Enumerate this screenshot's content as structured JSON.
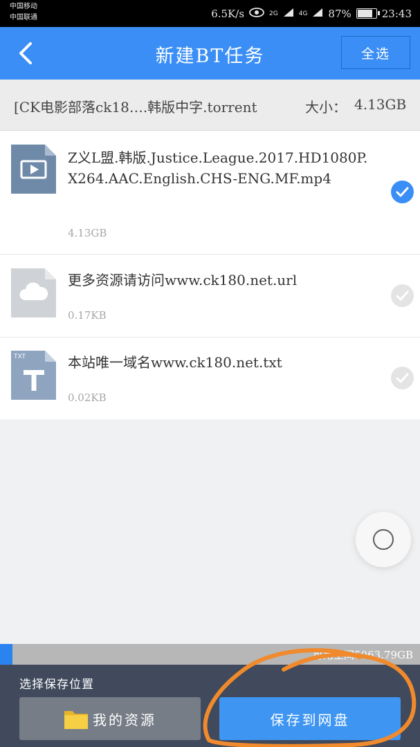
{
  "status_bar": {
    "carrier_1": "中国移动",
    "carrier_2": "中国联通",
    "speed": "6.5K/s",
    "signal_1": "2G",
    "signal_2": "4G",
    "battery": "87%",
    "battery_level": 0.87,
    "time": "23:43"
  },
  "header": {
    "title": "新建BT任务",
    "select_all": "全选"
  },
  "torrent": {
    "name": "[CK电影部落ck18….韩版中字.torrent",
    "size_label": "大小：",
    "size": "4.13GB"
  },
  "files": [
    {
      "name": "Z义L盟.韩版.Justice.League.2017.HD1080P.X264.AAC.English.CHS-ENG.MF.mp4",
      "size": "4.13GB",
      "icon": "video-file-icon",
      "checked": true
    },
    {
      "name": "更多资源请访问www.ck180.net.url",
      "size": "0.17KB",
      "icon": "cloud-file-icon",
      "checked": false
    },
    {
      "name": "本站唯一域名www.ck180.net.txt",
      "size": "0.02KB",
      "icon": "txt-file-icon",
      "icon_text": "TXT",
      "checked": false
    }
  ],
  "storage": {
    "available": "可用空间5063.79GB",
    "used_fraction": 0.03
  },
  "bottom": {
    "choose_location": "选择保存位置",
    "my_resources": "我的资源",
    "save_to_cloud": "保存到网盘"
  },
  "colors": {
    "accent": "#3a8ef5",
    "bottom_panel": "#404a5c",
    "annotation": "#f08a2c"
  }
}
